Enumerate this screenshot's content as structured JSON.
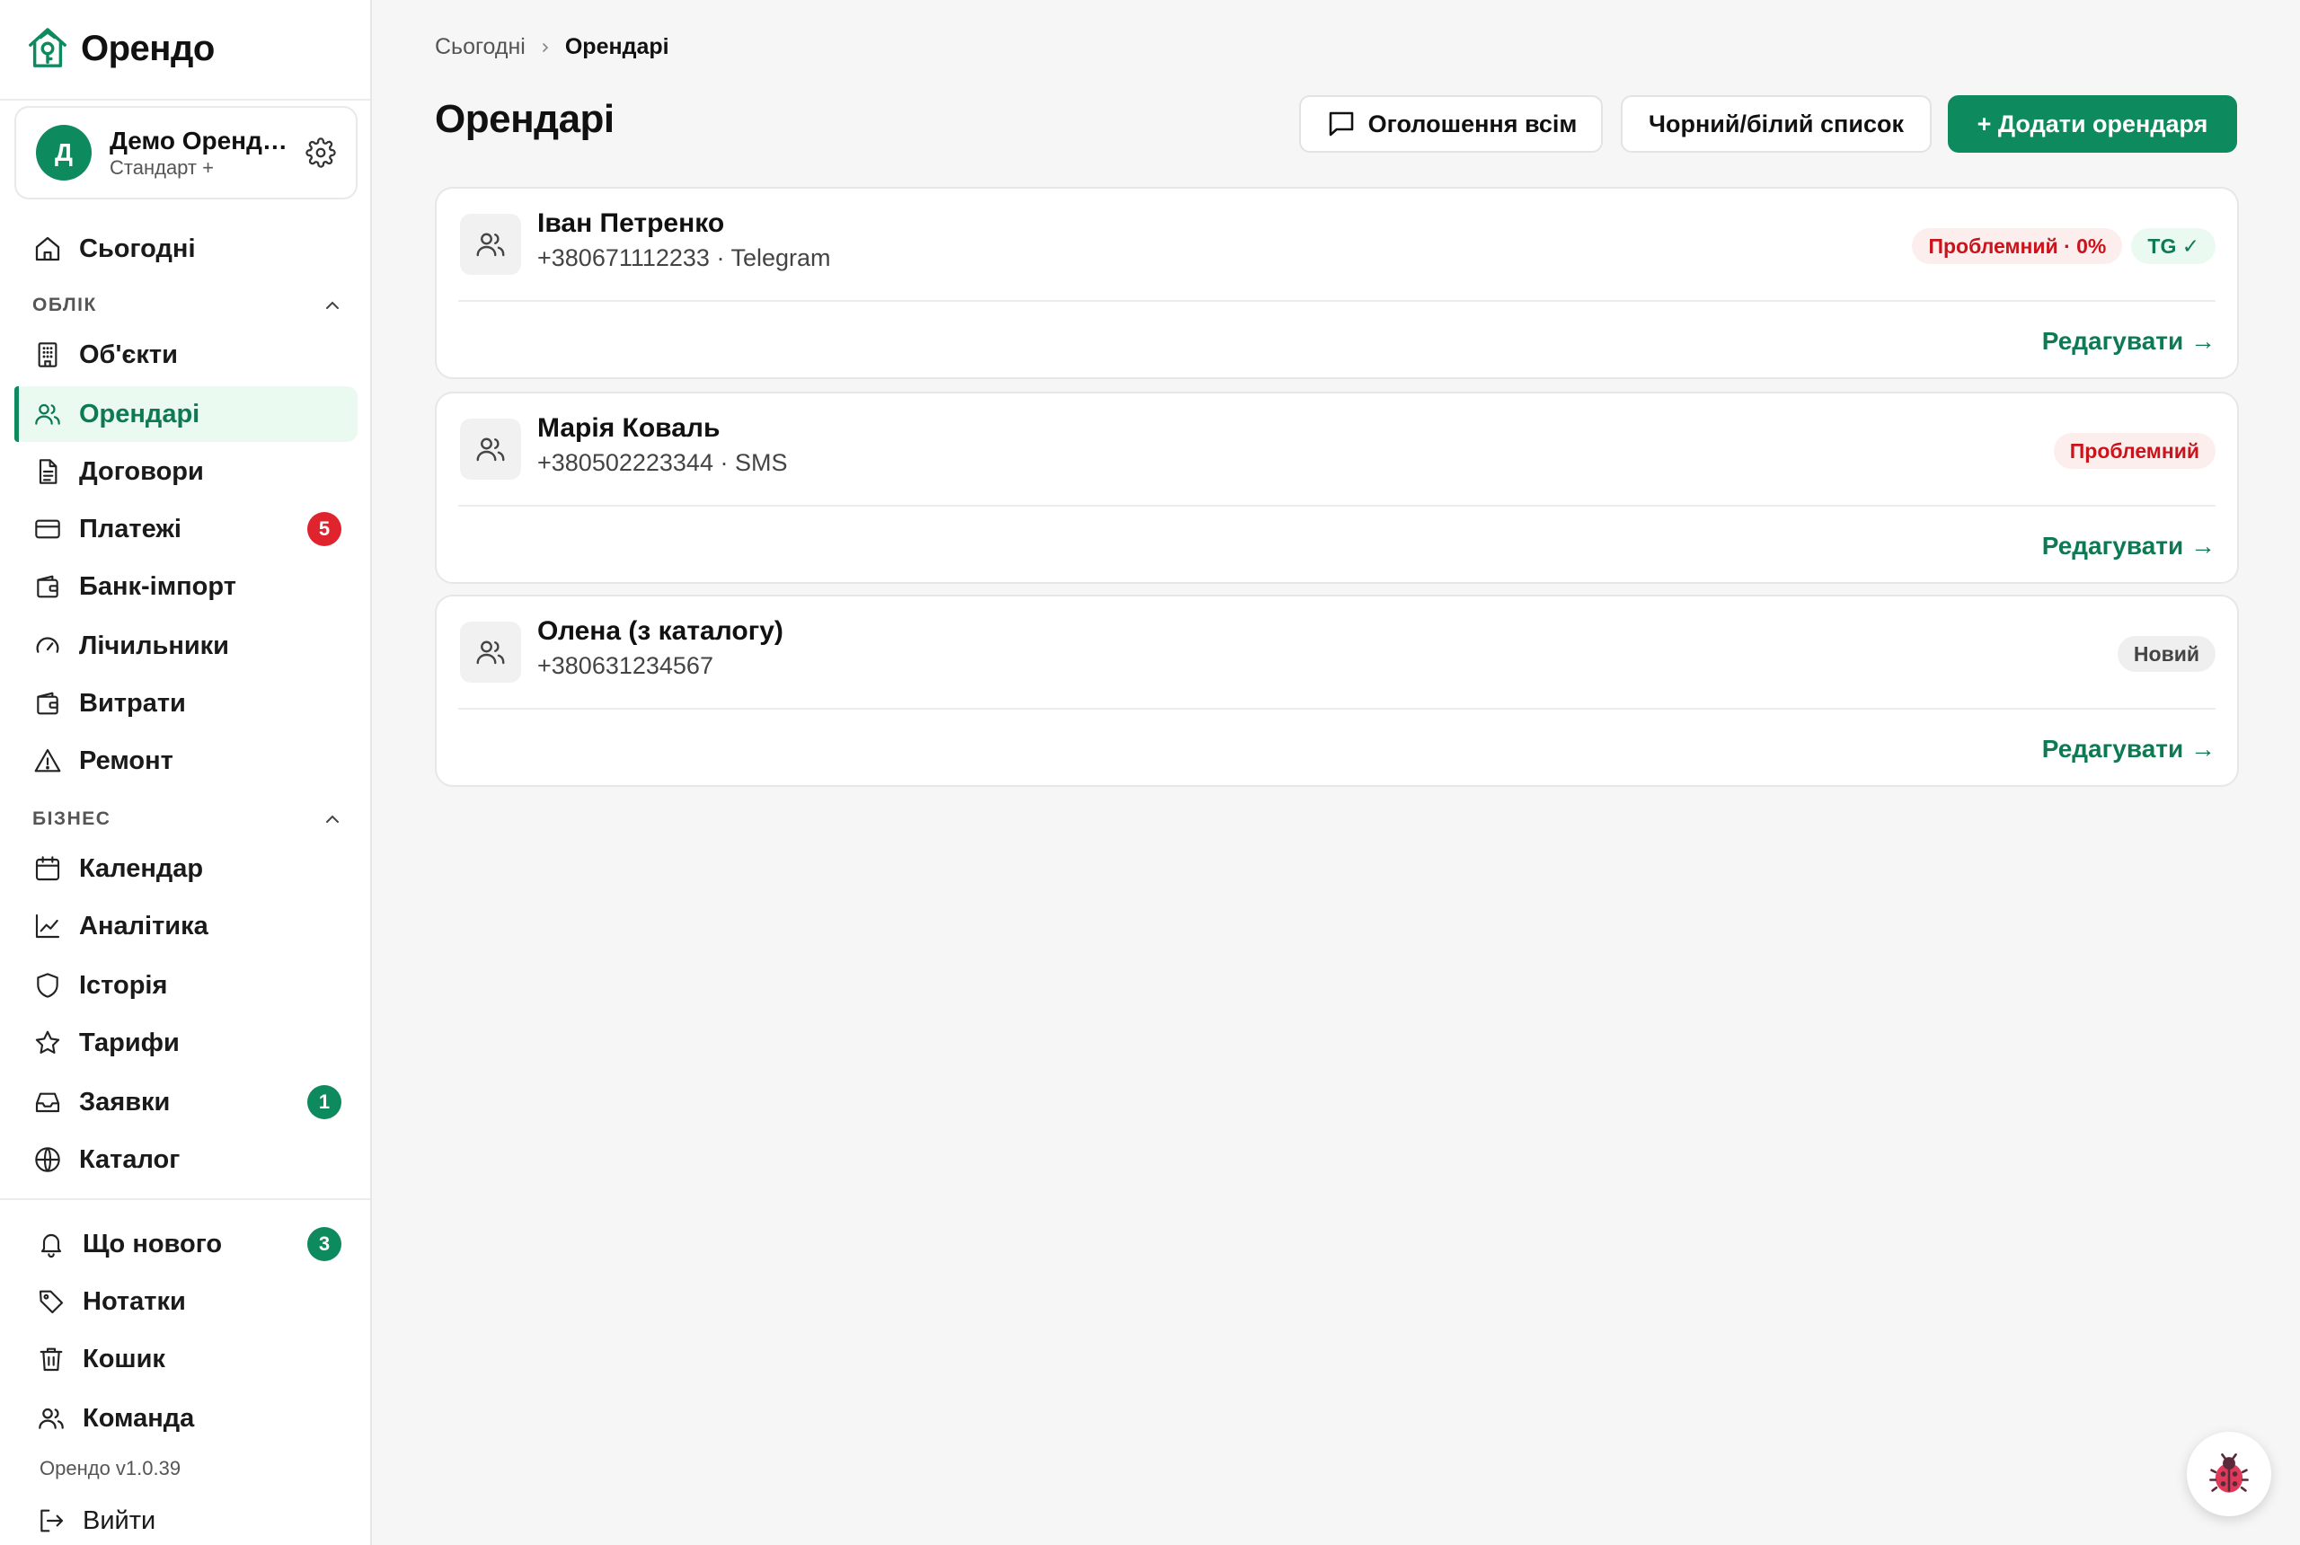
{
  "app": {
    "name": "Орендо",
    "version": "Орендо v1.0.39"
  },
  "account": {
    "initial": "Д",
    "name": "Демо Орендодавець",
    "plan": "Стандарт +"
  },
  "sidebar": {
    "today": "Сьогодні",
    "section_accounting": "ОБЛІК",
    "accounting": [
      {
        "label": "Об'єкти",
        "icon": "building-icon"
      },
      {
        "label": "Орендарі",
        "icon": "users-icon",
        "active": true
      },
      {
        "label": "Договори",
        "icon": "document-icon"
      },
      {
        "label": "Платежі",
        "icon": "credit-card-icon",
        "badge": "5"
      },
      {
        "label": "Банк-імпорт",
        "icon": "wallet-icon"
      },
      {
        "label": "Лічильники",
        "icon": "gauge-icon"
      },
      {
        "label": "Витрати",
        "icon": "wallet-icon"
      },
      {
        "label": "Ремонт",
        "icon": "warning-icon"
      }
    ],
    "section_business": "БІЗНЕС",
    "business": [
      {
        "label": "Календар",
        "icon": "calendar-icon"
      },
      {
        "label": "Аналітика",
        "icon": "chart-line-icon"
      },
      {
        "label": "Історія",
        "icon": "shield-icon"
      },
      {
        "label": "Тарифи",
        "icon": "star-icon"
      },
      {
        "label": "Заявки",
        "icon": "inbox-icon",
        "badge": "1"
      },
      {
        "label": "Каталог",
        "icon": "globe-icon"
      }
    ],
    "bottom": [
      {
        "label": "Що нового",
        "icon": "bell-icon",
        "badge": "3"
      },
      {
        "label": "Нотатки",
        "icon": "tag-icon"
      },
      {
        "label": "Кошик",
        "icon": "trash-icon"
      },
      {
        "label": "Команда",
        "icon": "users-icon"
      }
    ],
    "logout": "Вийти"
  },
  "breadcrumb": {
    "home": "Сьогодні",
    "current": "Орендарі"
  },
  "page": {
    "title": "Орендарі"
  },
  "actions": {
    "announce": "Оголошення всім",
    "blacklist": "Чорний/білий список",
    "add": "+ Додати орендаря"
  },
  "tenants": [
    {
      "name": "Іван Петренко",
      "contact": "+380671112233 · Telegram",
      "tags": [
        "Проблемний · 0%",
        "TG ✓"
      ],
      "edit": "Редагувати →"
    },
    {
      "name": "Марія Коваль",
      "contact": "+380502223344 · SMS",
      "tags": [
        "Проблемний"
      ],
      "edit": "Редагувати →"
    },
    {
      "name": "Олена (з каталогу)",
      "contact": "+380631234567",
      "tags": [
        "Новий"
      ],
      "edit": "Редагувати →"
    }
  ],
  "colors": {
    "brand": "#0e8a5f",
    "danger": "#e0242d"
  }
}
